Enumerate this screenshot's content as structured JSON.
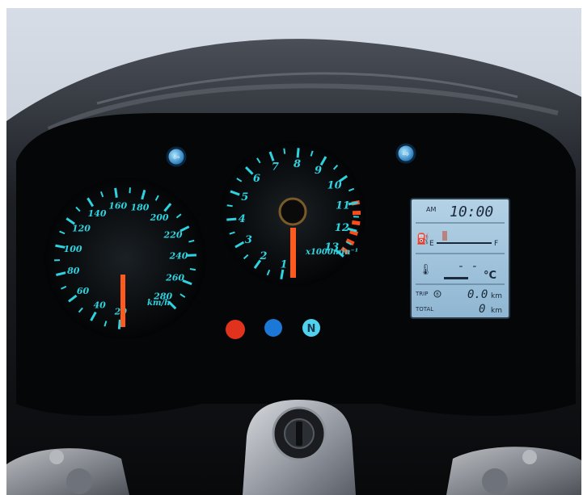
{
  "speedometer": {
    "labels": [
      "20",
      "40",
      "60",
      "80",
      "100",
      "120",
      "140",
      "160",
      "180",
      "200",
      "220",
      "240",
      "260",
      "280"
    ],
    "unit": "km/h",
    "reading_kmh": 0
  },
  "tachometer": {
    "labels": [
      "1",
      "2",
      "3",
      "4",
      "5",
      "6",
      "7",
      "8",
      "9",
      "10",
      "11",
      "12",
      "13"
    ],
    "unit": "x1000min⁻¹",
    "reading_krpm": 0
  },
  "indicators": {
    "neutral_label": "N",
    "warning_color": "#e0321c",
    "highbeam_color": "#1b78d6",
    "neutral_color": "#4fd2ee"
  },
  "lcd": {
    "ampm": "AM",
    "clock": "10:00",
    "fuel_empty": "E",
    "fuel_full": "F",
    "temp_value": "- -",
    "temp_unit": "°C",
    "trip_label": "TRIP",
    "trip_b": "B",
    "trip_value": "0.0",
    "trip_unit": "km",
    "total_label": "TOTAL",
    "total_value": "0",
    "total_unit": "km"
  },
  "colors": {
    "gauge_accent": "#2fd3e0",
    "needle": "#ff5a1e",
    "lcd_bg": "#9fc3dc"
  }
}
